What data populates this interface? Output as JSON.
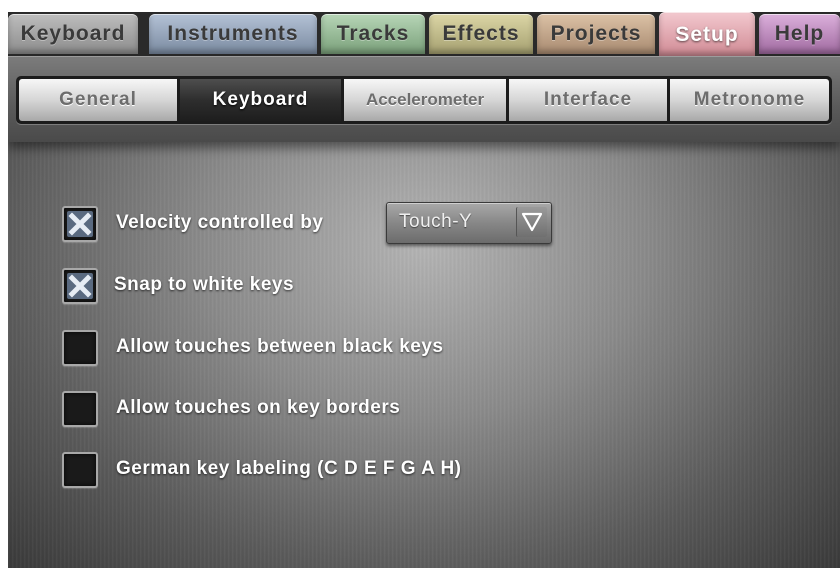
{
  "top_tabs": [
    {
      "label": "Keyboard",
      "color": "#8c8c8c",
      "active": false
    },
    {
      "label": "Instruments",
      "color": "#7a8aa0",
      "active": false
    },
    {
      "label": "Tracks",
      "color": "#7aa07a",
      "active": false
    },
    {
      "label": "Effects",
      "color": "#a5a070",
      "active": false
    },
    {
      "label": "Projects",
      "color": "#a88a70",
      "active": false
    },
    {
      "label": "Setup",
      "color": "#e0a0a8",
      "active": true
    },
    {
      "label": "Help",
      "color": "#b47ab4",
      "active": false
    }
  ],
  "sub_tabs": [
    {
      "label": "General",
      "active": false
    },
    {
      "label": "Keyboard",
      "active": true
    },
    {
      "label": "Accelerometer",
      "active": false
    },
    {
      "label": "Interface",
      "active": false
    },
    {
      "label": "Metronome",
      "active": false
    }
  ],
  "options": [
    {
      "label": "Velocity controlled by",
      "checked": true
    },
    {
      "label": "Snap to white keys",
      "checked": true
    },
    {
      "label": "Allow touches between black keys",
      "checked": false
    },
    {
      "label": "Allow touches on key borders",
      "checked": false
    },
    {
      "label": "German key labeling (C D E F G A H)",
      "checked": false
    }
  ],
  "velocity_dropdown": {
    "value": "Touch-Y",
    "icon": "triangle-down-icon"
  },
  "check_icon": "x-mark-icon"
}
